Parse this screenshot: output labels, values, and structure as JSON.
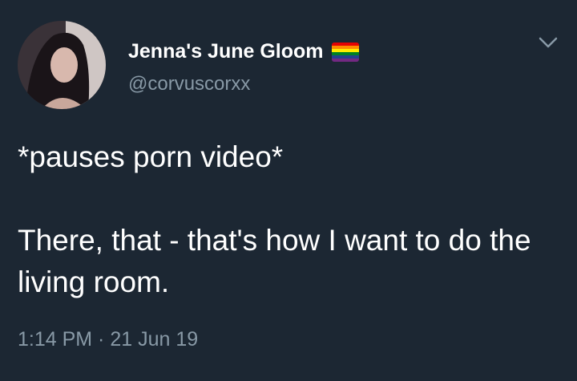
{
  "tweet": {
    "author": {
      "display_name": "Jenna's June Gloom",
      "handle": "@corvuscorxx",
      "badge_icon": "rainbow-flag-icon"
    },
    "text": {
      "line1": "*pauses porn video*",
      "line2": "There, that - that's how I want to do the living room."
    },
    "timestamp": "1:14 PM · 21 Jun 19",
    "menu_icon": "chevron-down-icon"
  },
  "colors": {
    "background": "#1c2733",
    "text_primary": "#ffffff",
    "text_secondary": "#8899a6"
  }
}
